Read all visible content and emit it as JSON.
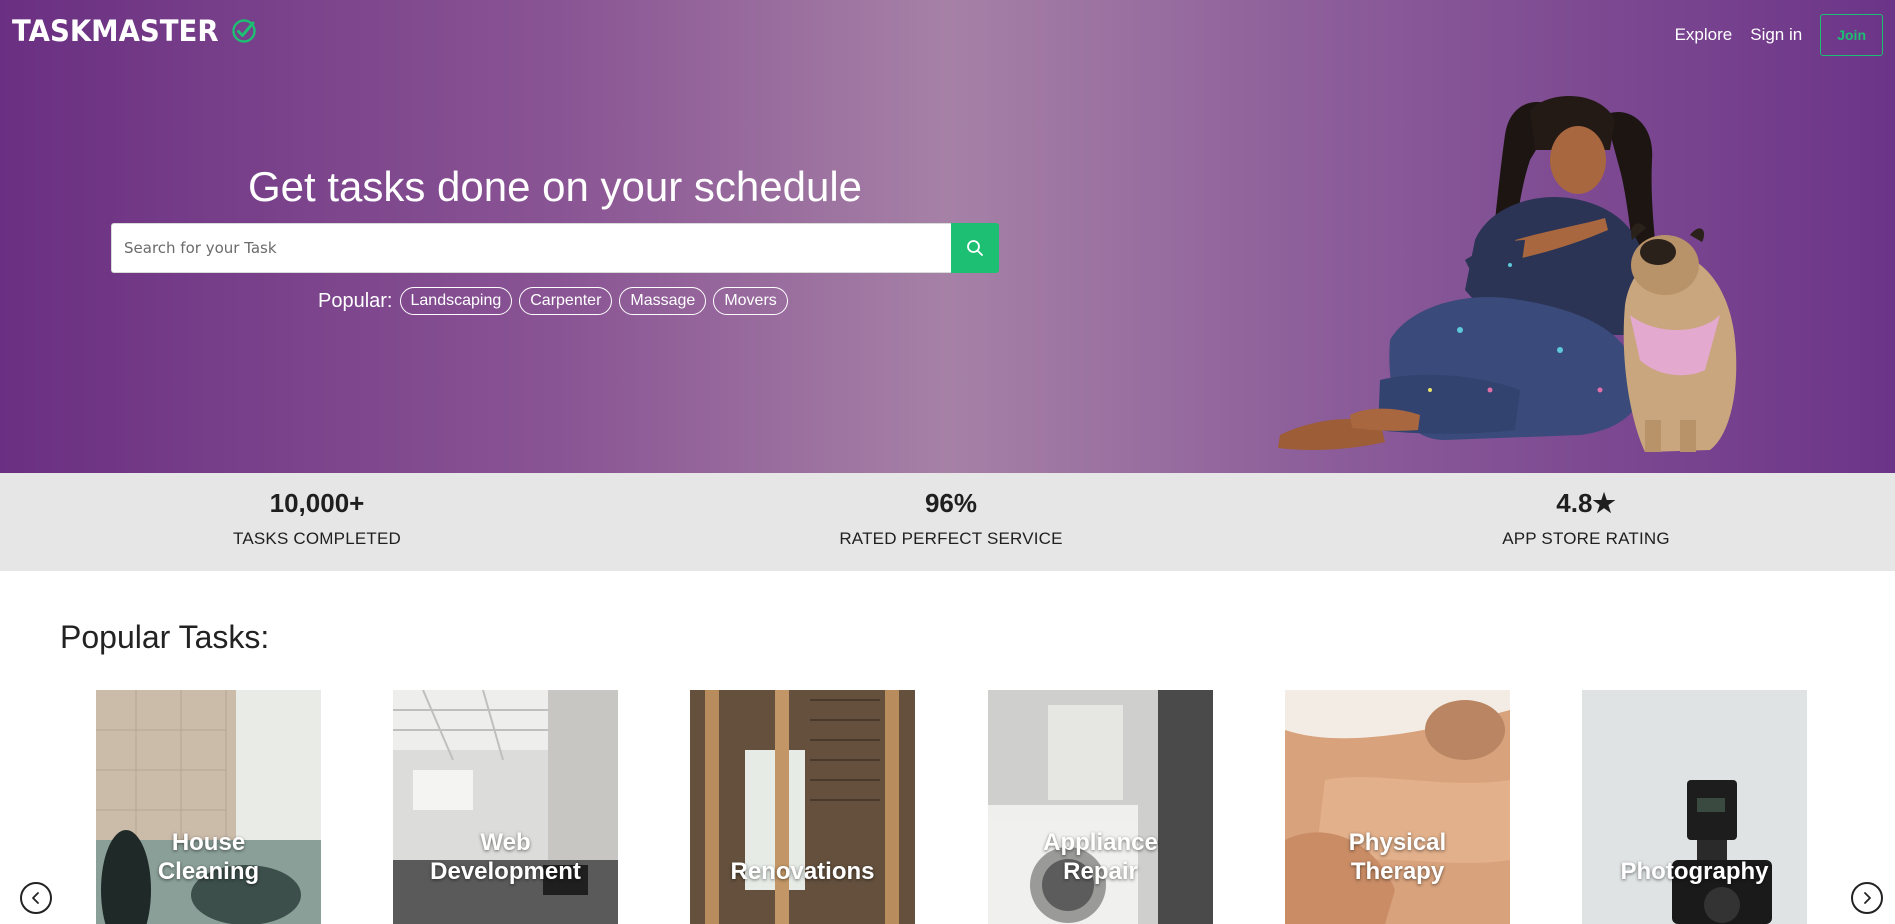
{
  "header": {
    "logo_text": "TASKMASTER",
    "nav": {
      "explore": "Explore",
      "sign_in": "Sign in",
      "join": "Join"
    }
  },
  "hero": {
    "headline": "Get tasks done on your schedule",
    "search": {
      "placeholder": "Search for your Task",
      "icon": "search-icon"
    },
    "popular_label": "Popular:",
    "popular_tags": [
      "Landscaping",
      "Carpenter",
      "Massage",
      "Movers"
    ]
  },
  "stats": [
    {
      "value": "10,000+",
      "label": "TASKS COMPLETED"
    },
    {
      "value": "96%",
      "label": "RATED PERFECT SERVICE"
    },
    {
      "value": "4.8★",
      "label": "APP STORE RATING"
    }
  ],
  "popular_tasks": {
    "title": "Popular Tasks:",
    "items": [
      {
        "line1": "House",
        "line2": "Cleaning"
      },
      {
        "line1": "Web",
        "line2": "Development"
      },
      {
        "line1": "",
        "line2": "Renovations"
      },
      {
        "line1": "Appliance",
        "line2": "Repair"
      },
      {
        "line1": "Physical",
        "line2": "Therapy"
      },
      {
        "line1": "",
        "line2": "Photography"
      }
    ],
    "prev_icon": "chevron-left-icon",
    "next_icon": "chevron-right-icon"
  },
  "colors": {
    "accent": "#1dbf73",
    "hero_start": "#6a2f82",
    "hero_mid": "#a681a6",
    "stats_bg": "#e6e6e6"
  }
}
